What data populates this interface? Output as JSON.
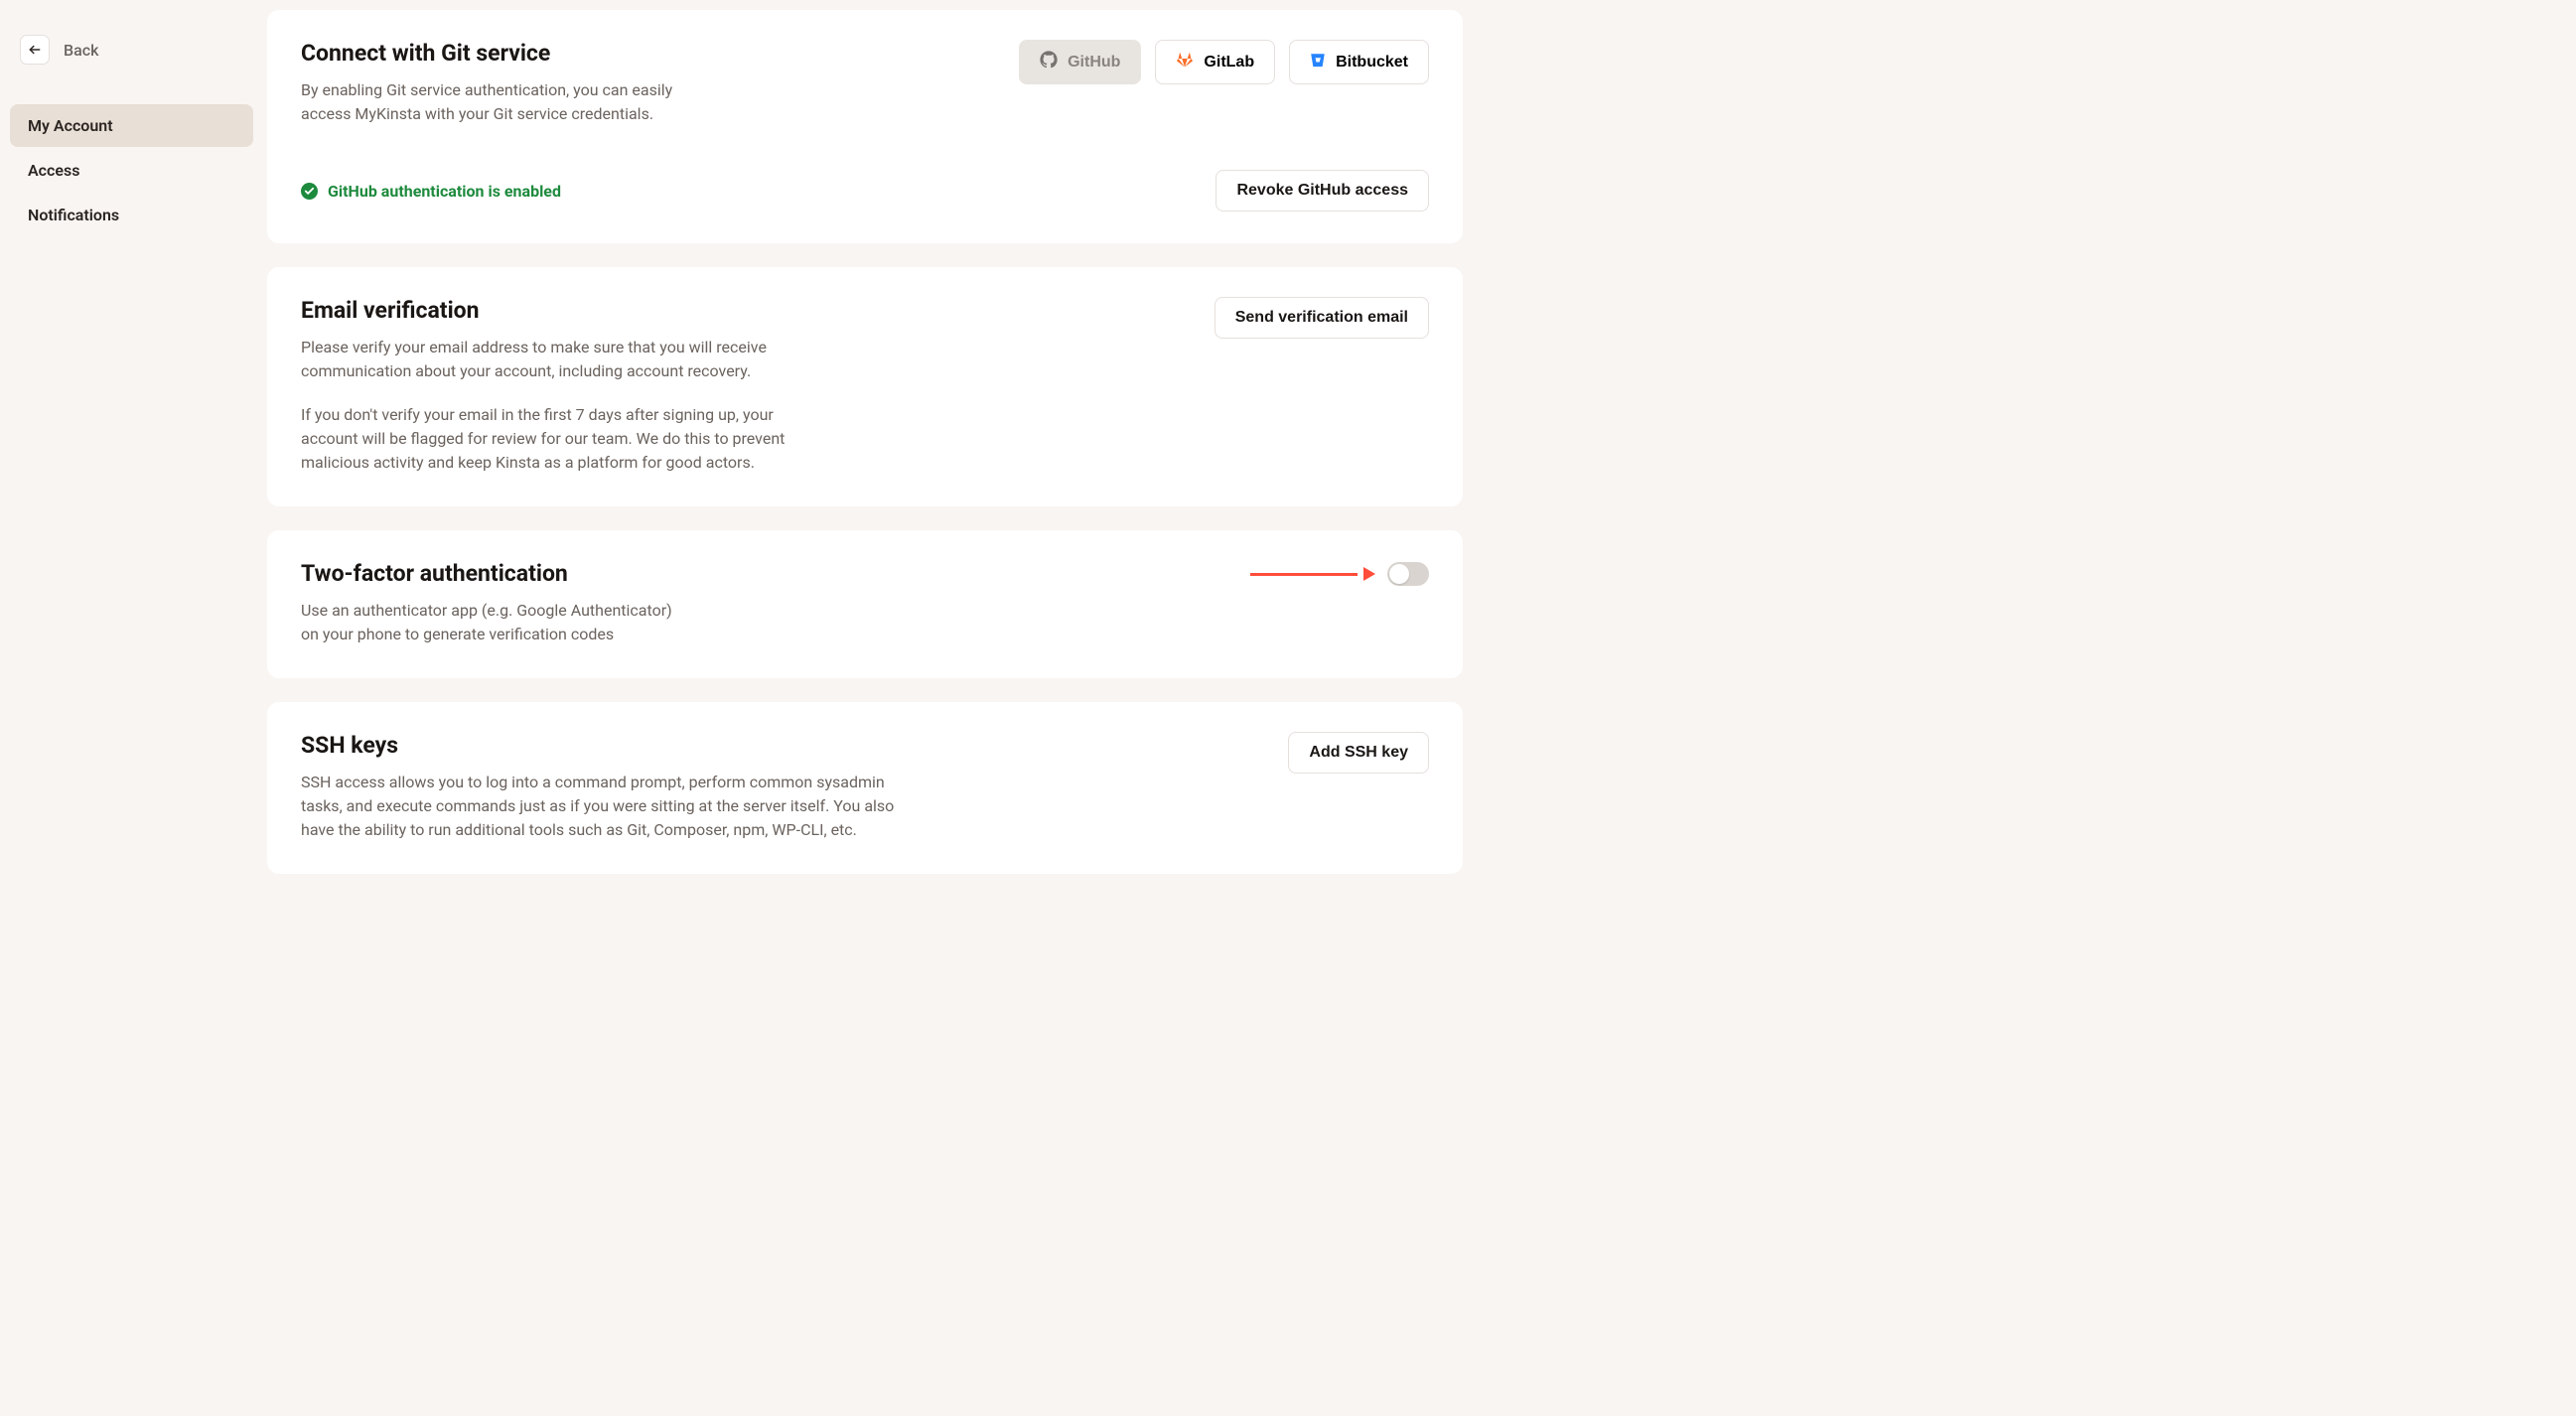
{
  "sidebar": {
    "back_label": "Back",
    "items": [
      {
        "label": "My Account"
      },
      {
        "label": "Access"
      },
      {
        "label": "Notifications"
      }
    ]
  },
  "git_card": {
    "title": "Connect with Git service",
    "description": "By enabling Git service authentication, you can easily access MyKinsta with your Git service credentials.",
    "providers": [
      {
        "label": "GitHub"
      },
      {
        "label": "GitLab"
      },
      {
        "label": "Bitbucket"
      }
    ],
    "status_text": "GitHub authentication is enabled",
    "revoke_label": "Revoke GitHub access"
  },
  "email_card": {
    "title": "Email verification",
    "description1": "Please verify your email address to make sure that you will receive communication about your account, including account recovery.",
    "description2": "If you don't verify your email in the first 7 days after signing up, your account will be flagged for review for our team. We do this to prevent malicious activity and keep Kinsta as a platform for good actors.",
    "send_label": "Send verification email"
  },
  "twofa_card": {
    "title": "Two-factor authentication",
    "description": "Use an authenticator app (e.g. Google Authenticator) on your phone to generate verification codes",
    "enabled": false
  },
  "ssh_card": {
    "title": "SSH keys",
    "description": "SSH access allows you to log into a command prompt, perform common sysadmin tasks, and execute commands just as if you were sitting at the server itself. You also have the ability to run additional tools such as Git, Composer, npm, WP-CLI, etc.",
    "add_label": "Add SSH key"
  }
}
